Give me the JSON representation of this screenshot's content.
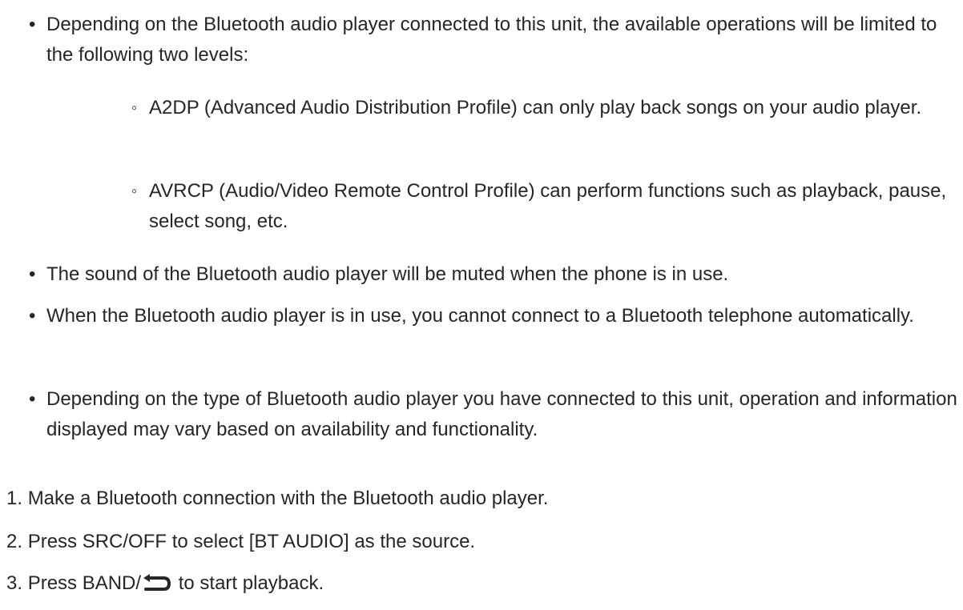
{
  "notes": [
    {
      "marker": "•",
      "text": "Depending on the Bluetooth audio player connected to this unit, the available operations will be limited to the following two levels:",
      "sub": [
        {
          "marker": "◦",
          "text": "A2DP (Advanced Audio Distribution Profile) can only play back songs on your audio player."
        },
        {
          "marker": "◦",
          "text": "AVRCP (Audio/Video Remote Control Profile) can perform functions such as playback, pause, select song, etc."
        }
      ]
    },
    {
      "marker": "•",
      "text": "The sound of the Bluetooth audio player will be muted when the phone is in use."
    },
    {
      "marker": "•",
      "text": "When the Bluetooth audio player is in use, you cannot connect to a Bluetooth telephone automatically."
    },
    {
      "marker": "•",
      "text": "Depending on the type of Bluetooth audio player you have connected to this unit, operation and information displayed may vary based on availability and functionality."
    }
  ],
  "steps": [
    {
      "number": "1.",
      "text": "Make a Bluetooth connection with the Bluetooth audio player."
    },
    {
      "number": "2.",
      "text": "Press SRC/OFF to select [BT AUDIO] as the source."
    },
    {
      "number": "3.",
      "before": "Press BAND/",
      "icon": "return-arrow-icon",
      "after": "to start playback."
    }
  ]
}
